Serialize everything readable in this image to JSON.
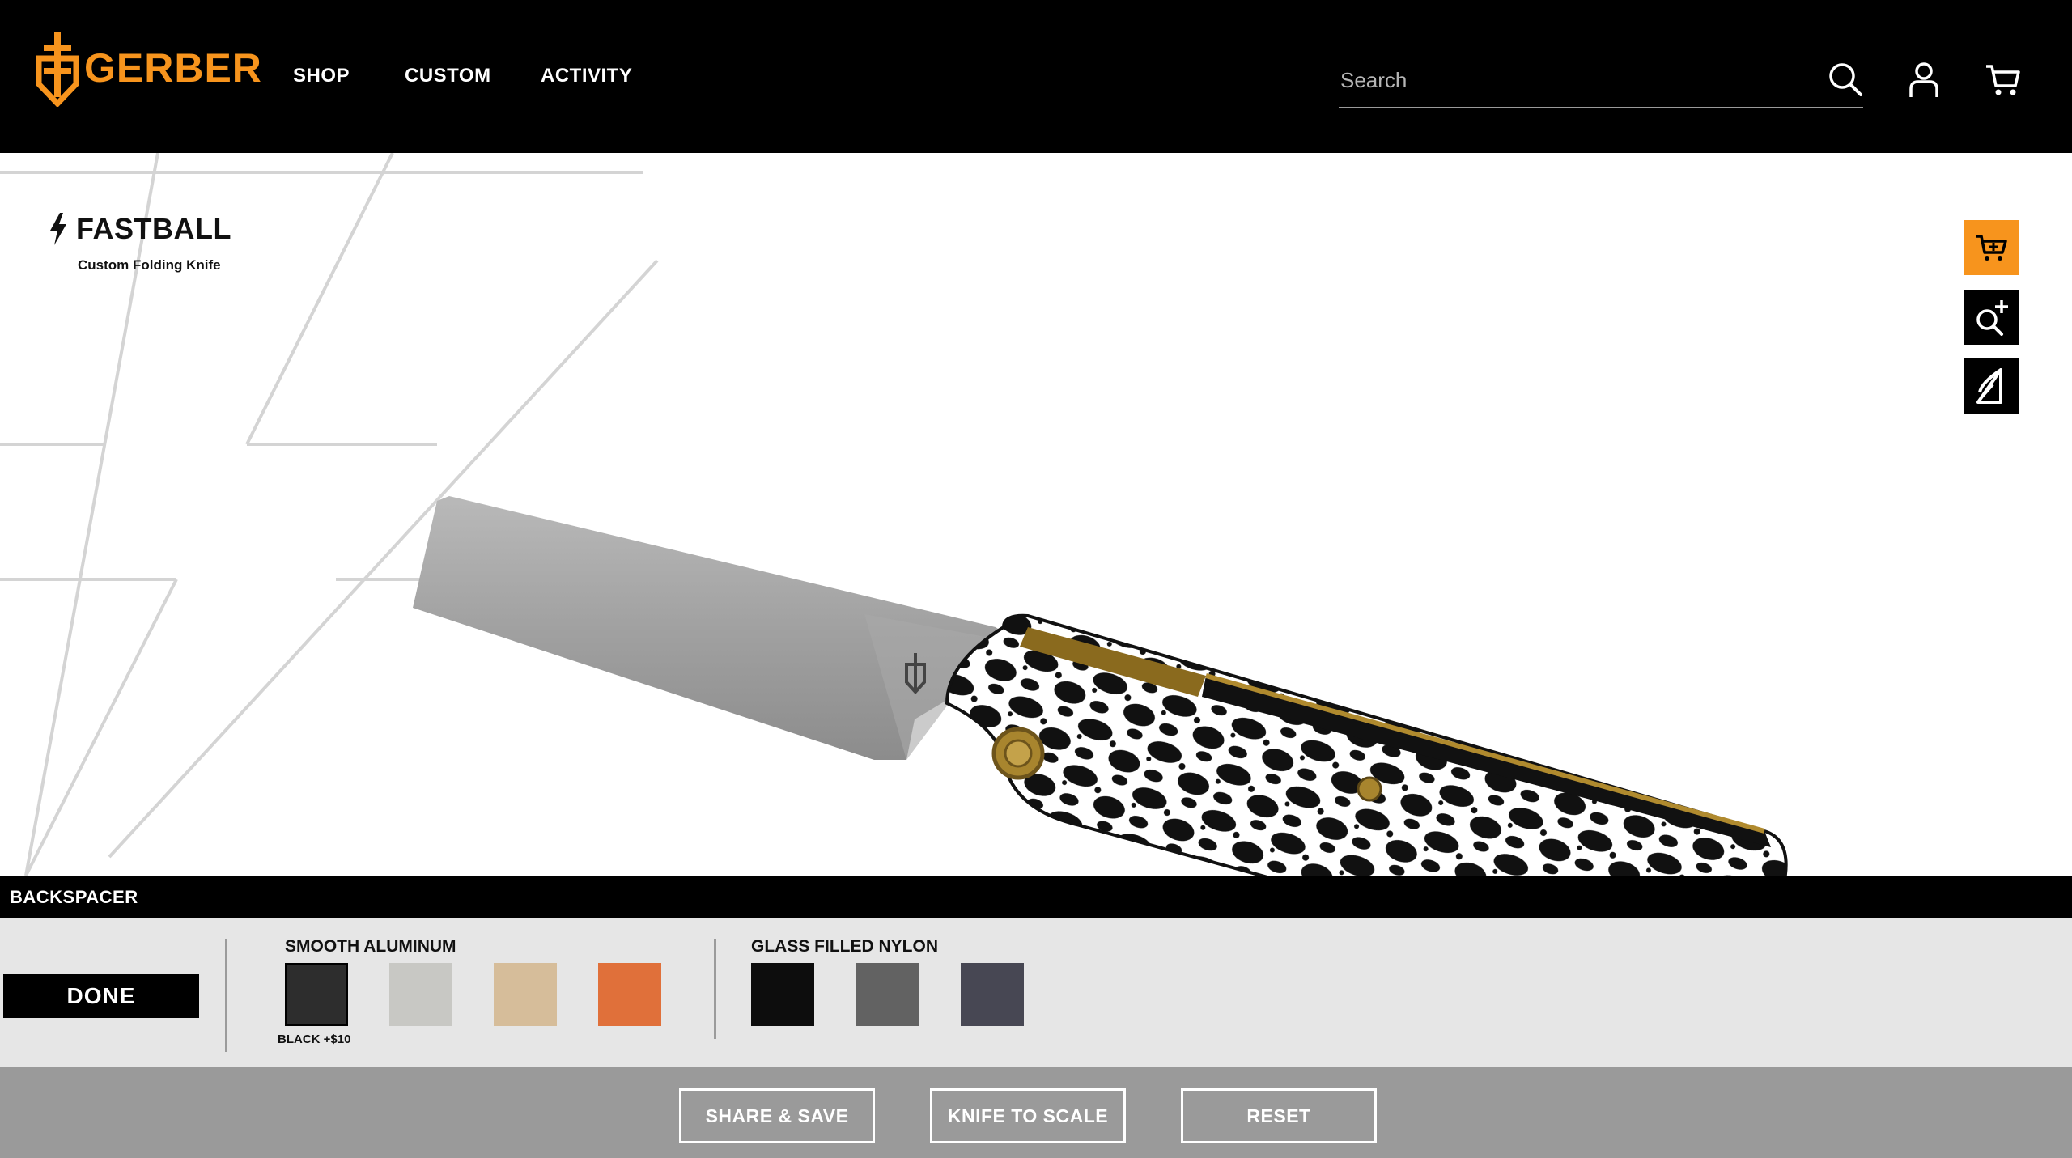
{
  "header": {
    "logo_text": "GERBER",
    "nav": {
      "shop": "SHOP",
      "custom": "CUSTOM",
      "activity": "ACTIVITY"
    },
    "search_placeholder": "Search",
    "icons": [
      "search-icon",
      "user-icon",
      "cart-icon"
    ]
  },
  "product": {
    "title": "FASTBALL",
    "subtitle": "Custom Folding Knife"
  },
  "tools": [
    "add-to-cart-icon",
    "zoom-in-icon",
    "ar-view-icon"
  ],
  "panel": {
    "section_label": "BACKSPACER",
    "done_label": "DONE",
    "groups": [
      {
        "label": "SMOOTH ALUMINUM",
        "swatches": [
          {
            "color": "#2d2d2d",
            "selected": true
          },
          {
            "color": "#c8c8c4",
            "selected": false
          },
          {
            "color": "#d6bd9a",
            "selected": false
          },
          {
            "color": "#e0703a",
            "selected": false
          }
        ],
        "selected_caption": "BLACK +$10"
      },
      {
        "label": "GLASS FILLED NYLON",
        "swatches": [
          {
            "color": "#0d0d0d",
            "selected": false
          },
          {
            "color": "#626262",
            "selected": false
          },
          {
            "color": "#474753",
            "selected": false
          }
        ]
      }
    ]
  },
  "footer": {
    "share_label": "SHARE & SAVE",
    "scale_label": "KNIFE TO SCALE",
    "reset_label": "RESET"
  },
  "colors": {
    "accent": "#f7941d",
    "header_bg": "#000000",
    "panel_bg": "#e6e6e6",
    "footer_bg": "#9a9a9a"
  }
}
